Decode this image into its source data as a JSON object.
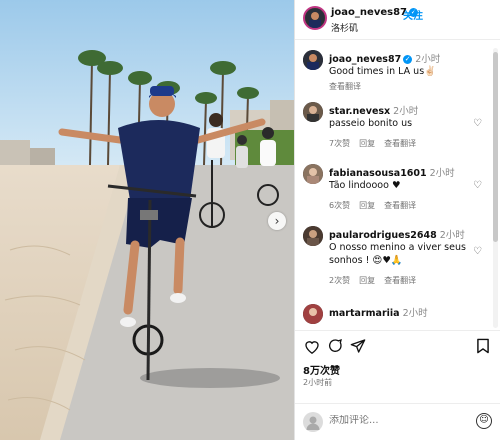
{
  "post": {
    "username": "joao_neves87",
    "follow_label": "关注",
    "location": "洛杉矶",
    "caption_time": "2小时",
    "caption": "Good times in LA us✌🏻",
    "translate_label": "查看翻译",
    "more_label": "•••"
  },
  "comments": [
    {
      "user": "star.nevesx",
      "time": "2小时",
      "text": "passeio bonito us",
      "likes": "7次赞",
      "reply": "回复",
      "translate": "查看翻译"
    },
    {
      "user": "fabianasousa1601",
      "time": "2小时",
      "text": "Tão lindoooo ♥",
      "likes": "6次赞",
      "reply": "回复",
      "translate": "查看翻译"
    },
    {
      "user": "paularodrigues2648",
      "time": "2小时",
      "text": "O nosso menino a viver seus sonhos ! 😍♥🙏",
      "likes": "2次赞",
      "reply": "回复",
      "translate": "查看翻译"
    },
    {
      "user": "martarmariia",
      "time": "2小时",
      "text": "",
      "likes": "",
      "reply": "",
      "translate": ""
    }
  ],
  "stats": {
    "likes": "8万次赞",
    "time_ago": "2小时前"
  },
  "add_comment": {
    "placeholder": "添加评论..."
  },
  "icons": {
    "like": "heart-icon",
    "comment": "comment-icon",
    "share": "share-icon",
    "save": "bookmark-icon",
    "emoji": "emoji-icon",
    "next": "chevron-right-icon"
  },
  "colors": {
    "accent": "#0095f6",
    "verified": "#0095f6",
    "meta_text": "#737373"
  }
}
